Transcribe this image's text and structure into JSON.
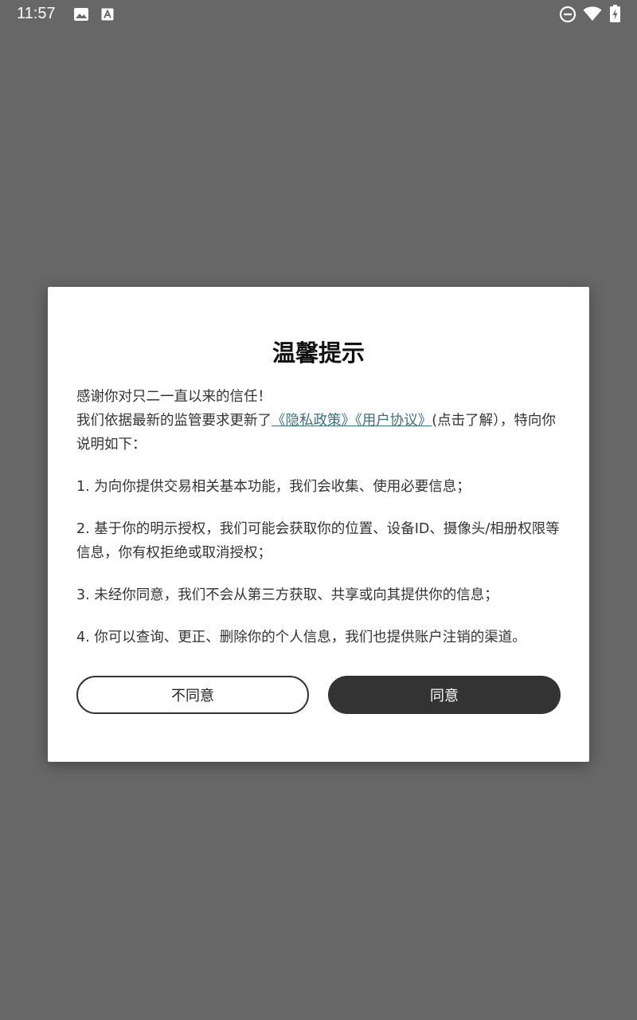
{
  "status_bar": {
    "time": "11:57",
    "left_icons": [
      "image-icon",
      "text-a-icon"
    ],
    "right_icons": [
      "do-not-disturb-icon",
      "wifi-icon",
      "battery-charging-icon"
    ]
  },
  "dialog": {
    "title": "温馨提示",
    "intro_line1": "感谢你对只二一直以来的信任！",
    "intro_line2_prefix": "我们依据最新的监管要求更新了",
    "privacy_link": "《隐私政策》",
    "user_agreement_link": "《用户协议》",
    "intro_line2_suffix": "(点击了解），特向你说明如下：",
    "items": [
      "1. 为向你提供交易相关基本功能，我们会收集、使用必要信息；",
      "2. 基于你的明示授权，我们可能会获取你的位置、设备ID、摄像头/相册权限等信息，你有权拒绝或取消授权；",
      "3. 未经你同意，我们不会从第三方获取、共享或向其提供你的信息；",
      "4. 你可以查询、更正、删除你的个人信息，我们也提供账户注销的渠道。"
    ],
    "decline_label": "不同意",
    "agree_label": "同意"
  },
  "colors": {
    "backdrop": "#676767",
    "link": "#3f6f7d",
    "primary_button": "#333333"
  }
}
